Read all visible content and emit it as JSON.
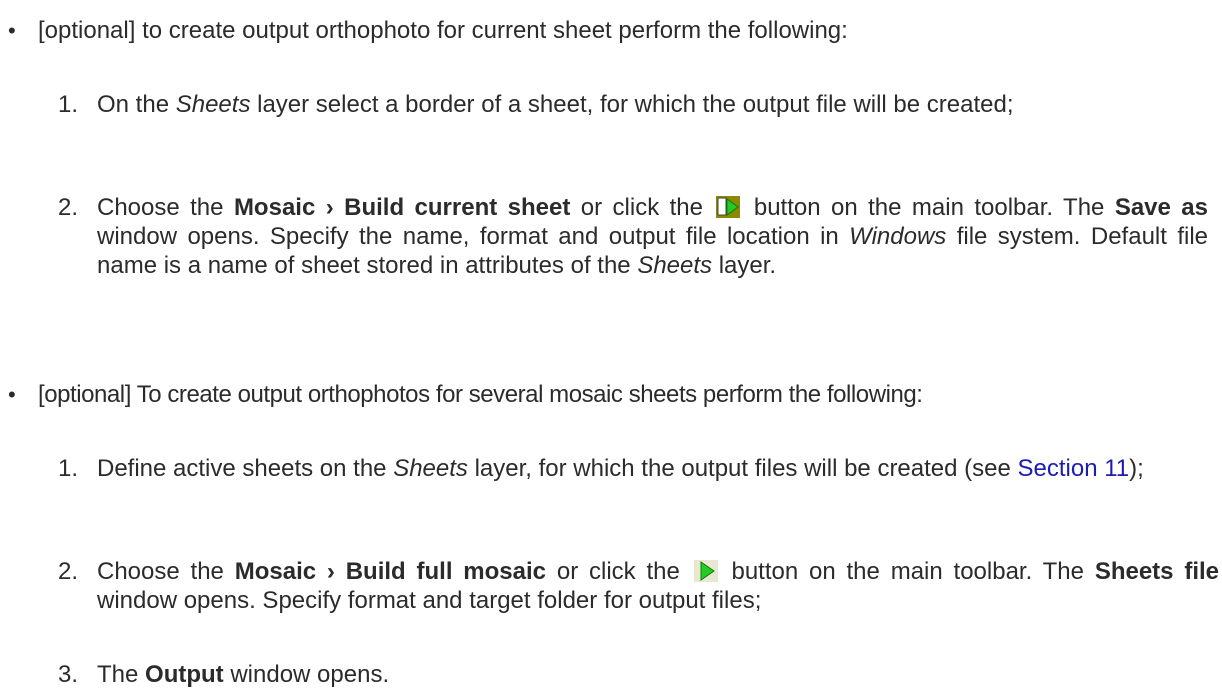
{
  "items": [
    {
      "bullet": "•",
      "text": "[optional] to create output orthophoto for current sheet perform the following:",
      "steps": [
        {
          "num": "1.",
          "pre": "On the ",
          "layer": "Sheets",
          "post": " layer select a border of a sheet, for which the output file will be created;"
        },
        {
          "num": "2.",
          "pre": "Choose the ",
          "menu": "Mosaic › Build current sheet",
          "mid": " or click the ",
          "icon": "build-current-sheet-icon",
          "post1": " button on the main toolbar. The ",
          "window": "Save as",
          "post2": " window opens. Specify the name, format and output file location in ",
          "os": "Windows",
          "post3": " file system. Default file name is a name of sheet stored in attributes of the ",
          "layer": "Sheets",
          "post4": " layer."
        }
      ]
    },
    {
      "bullet": "•",
      "text": "[optional] To create output orthophotos for several mosaic sheets perform the following:",
      "steps": [
        {
          "num": "1.",
          "pre": "Define active sheets on the ",
          "layer": "Sheets",
          "post": " layer, for which the output files will be created (see ",
          "link": "Section 11",
          "post2": ");"
        },
        {
          "num": "2.",
          "pre": "Choose the ",
          "menu": "Mosaic › Build full mosaic",
          "mid": " or click the ",
          "icon": "build-full-mosaic-icon",
          "post1": " button on the main toolbar. The ",
          "window": "Sheets file",
          "post2": " window opens. Specify format and target folder for output files;"
        },
        {
          "num": "3.",
          "pre": "The ",
          "window": "Output",
          "post": " window opens."
        }
      ]
    }
  ],
  "colors": {
    "text": "#2b2b2b",
    "link": "#1c1cb0",
    "icon_green": "#22cc22",
    "icon_olive": "#8a8a00"
  }
}
